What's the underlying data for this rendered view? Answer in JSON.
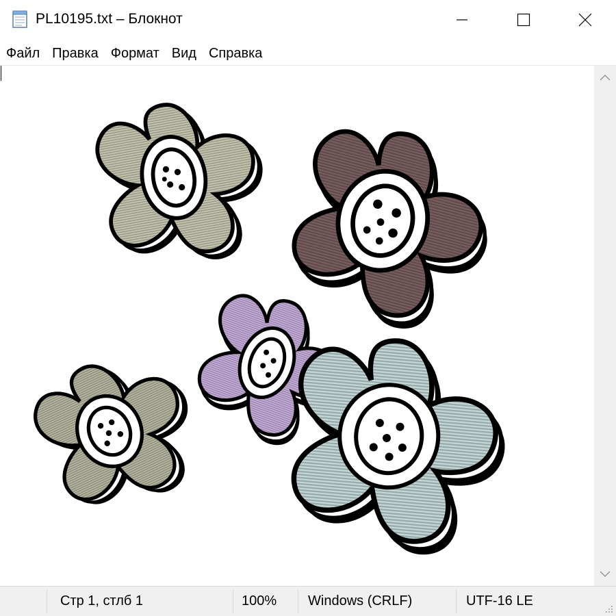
{
  "window": {
    "title": "PL10195.txt – Блокнот",
    "icon": "notepad-icon"
  },
  "controls": {
    "minimize_icon": "minimize-icon",
    "maximize_icon": "maximize-icon",
    "close_icon": "close-icon"
  },
  "menu": {
    "items": [
      "Файл",
      "Правка",
      "Формат",
      "Вид",
      "Справка"
    ]
  },
  "editor": {
    "content_description_icons": [
      "flower-icon"
    ],
    "flower_colors": [
      "#c9c8b2",
      "#7a5f61",
      "#c9b0df",
      "#c5dada",
      "#b9b9a3"
    ]
  },
  "statusbar": {
    "position": "Стр 1, стлб 1",
    "zoom": "100%",
    "line_ending": "Windows (CRLF)",
    "encoding": "UTF-16 LE"
  },
  "colors": {
    "status_bg": "#f0f0f0",
    "scrollbar_bg": "#f0f0f0"
  }
}
